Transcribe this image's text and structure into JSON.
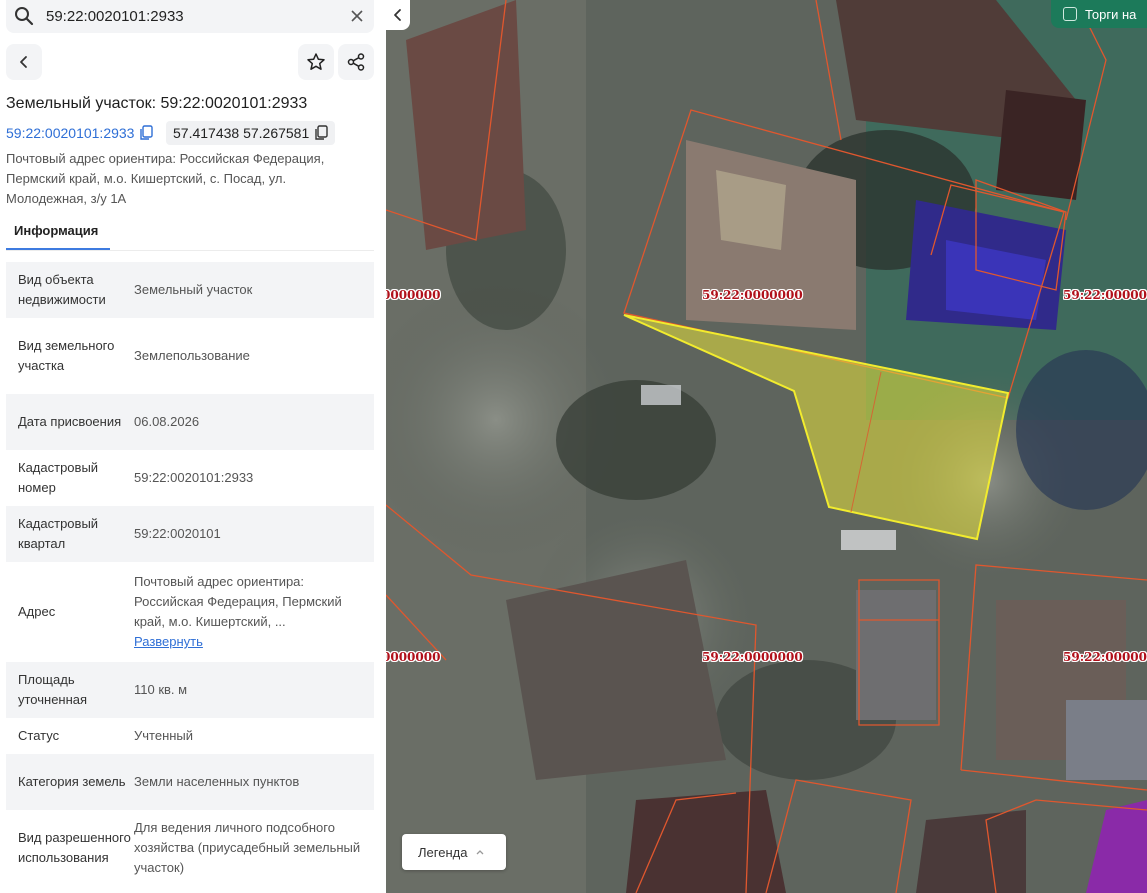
{
  "search": {
    "value": "59:22:0020101:2933"
  },
  "header": {
    "title": "Земельный участок: 59:22:0020101:2933",
    "cad_link": "59:22:0020101:2933",
    "coords": "57.417438 57.267581",
    "address": "Почтовый адрес ориентира: Российская Федерация, Пермский край, м.о. Кишертский, с. Посад, ул. Молодежная, з/у 1А"
  },
  "tabs": [
    {
      "label": "Информация"
    }
  ],
  "info_rows": [
    {
      "key": "Вид объекта недвижимости",
      "value": "Земельный участок"
    },
    {
      "key": "Вид земельного участка",
      "value": "Землепользование"
    },
    {
      "key": "Дата присвоения",
      "value": "06.08.2026"
    },
    {
      "key": "Кадастровый номер",
      "value": "59:22:0020101:2933"
    },
    {
      "key": "Кадастровый квартал",
      "value": "59:22:0020101"
    },
    {
      "key": "Адрес",
      "value": "Почтовый адрес ориентира: Российская Федерация, Пермский край, м.о. Кишертский, ...",
      "link": "Развернуть"
    },
    {
      "key": "Площадь уточненная",
      "value": "110 кв. м"
    },
    {
      "key": "Статус",
      "value": "Учтенный"
    },
    {
      "key": "Категория земель",
      "value": "Земли населенных пунктов"
    },
    {
      "key": "Вид разрешенного использования",
      "value": "Для ведения личного подсобного хозяйства (приусадебный земельный участок)"
    }
  ],
  "map": {
    "torgi_label": "Торги на",
    "legend_label": "Легенда",
    "parcel_labels": [
      "0000000",
      "59:22:0000000",
      "59:22:000000",
      "0000000",
      "59:22:0000000",
      "59:22:0000000"
    ],
    "colors": {
      "parcel_border": "#e0572e",
      "selected_fill": "#e8e23a",
      "selected_border": "#f2ec2e",
      "label": "#b0101a",
      "torgi_bg": "#1c7a5a"
    }
  }
}
